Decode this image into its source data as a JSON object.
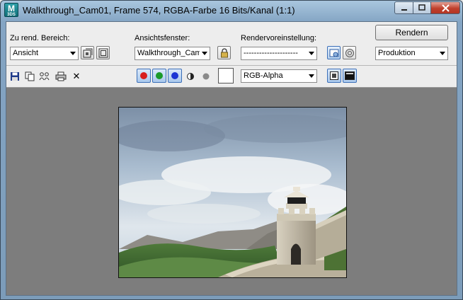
{
  "window": {
    "title": "Walkthrough_Cam01, Frame 574, RGBA-Farbe 16 Bits/Kanal (1:1)",
    "logo_main": "M",
    "logo_sub": "3DS"
  },
  "render_area": {
    "label": "Zu rend. Bereich:",
    "value": "Ansicht"
  },
  "viewport_select": {
    "label": "Ansichtsfenster:",
    "value": "Walkthrough_Cam"
  },
  "preset": {
    "label": "Rendervoreinstellung:",
    "value": "---------------------"
  },
  "render_button": "Rendern",
  "production": {
    "value": "Produktion"
  },
  "channel_display": {
    "value": "RGB-Alpha"
  },
  "channels": [
    {
      "name": "red",
      "color": "#d81e1e"
    },
    {
      "name": "green",
      "color": "#1b9a2a"
    },
    {
      "name": "blue",
      "color": "#1c35d4"
    }
  ],
  "icons": {
    "close_toolbar": "✕"
  }
}
